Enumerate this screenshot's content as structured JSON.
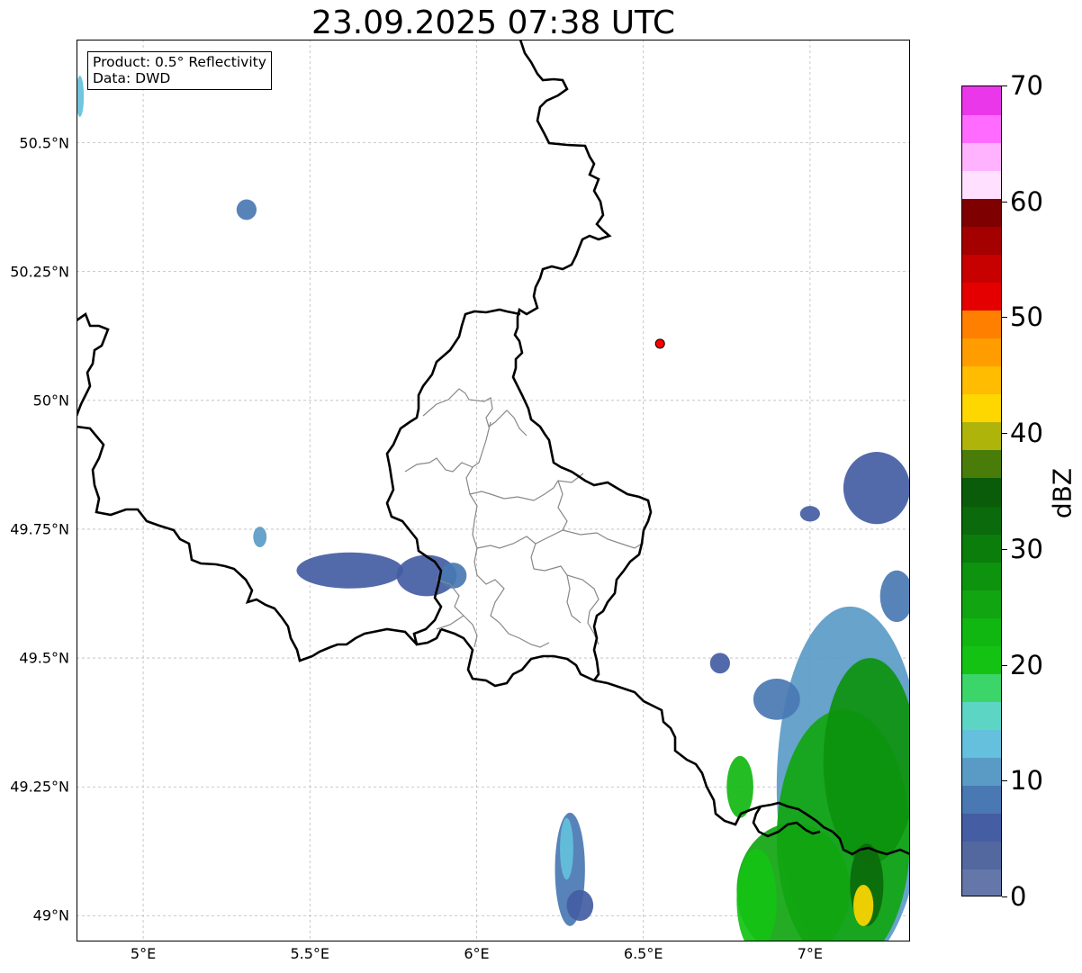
{
  "title": "23.09.2025 07:38 UTC",
  "info": {
    "product": "Product: 0.5° Reflectivity",
    "data": "Data: DWD"
  },
  "colorbar": {
    "label": "dBZ",
    "min": 0,
    "max": 70,
    "ticks": [
      "0",
      "10",
      "20",
      "30",
      "40",
      "50",
      "60",
      "70"
    ],
    "colors": [
      "#6577a9",
      "#52689f",
      "#445da3",
      "#4978b3",
      "#5a9bc6",
      "#64c0dc",
      "#5dd5c4",
      "#3cd569",
      "#14c214",
      "#11b711",
      "#11a511",
      "#0d930d",
      "#0b7d0b",
      "#0b6a0b",
      "#0a5c0a",
      "#4a7c0a",
      "#afb40a",
      "#ffd700",
      "#ffbc00",
      "#ff9d00",
      "#ff7f00",
      "#e40000",
      "#c70000",
      "#a50000",
      "#7f0000",
      "#ffe1ff",
      "#ffb3ff",
      "#ff6bff",
      "#ea37ea"
    ]
  },
  "map": {
    "lon_range": [
      4.8,
      7.3
    ],
    "lat_range": [
      48.95,
      50.7
    ],
    "lat_ticks": [
      {
        "value": 49.0,
        "label": "49°N"
      },
      {
        "value": 49.25,
        "label": "49.25°N"
      },
      {
        "value": 49.5,
        "label": "49.5°N"
      },
      {
        "value": 49.75,
        "label": "49.75°N"
      },
      {
        "value": 50.0,
        "label": "50°N"
      },
      {
        "value": 50.25,
        "label": "50.25°N"
      },
      {
        "value": 50.5,
        "label": "50.5°N"
      }
    ],
    "lon_ticks": [
      {
        "value": 5.0,
        "label": "5°E"
      },
      {
        "value": 5.5,
        "label": "5.5°E"
      },
      {
        "value": 6.0,
        "label": "6°E"
      },
      {
        "value": 6.5,
        "label": "6.5°E"
      },
      {
        "value": 7.0,
        "label": "7°E"
      }
    ],
    "radar_site": {
      "lon": 6.55,
      "lat": 50.11,
      "color": "#ff0000"
    },
    "gridline_color": "#bbbbbb",
    "border_color": "#000000",
    "district_color": "#888888"
  },
  "echoes": [
    {
      "lon": 6.28,
      "lat": 49.09,
      "rlon": 0.045,
      "rlat": 0.11,
      "dbz": 8
    },
    {
      "lon": 6.27,
      "lat": 49.13,
      "rlon": 0.02,
      "rlat": 0.06,
      "dbz": 13
    },
    {
      "lon": 6.31,
      "lat": 49.02,
      "rlon": 0.04,
      "rlat": 0.03,
      "dbz": 5
    },
    {
      "lon": 5.62,
      "lat": 49.67,
      "rlon": 0.16,
      "rlat": 0.035,
      "dbz": 5
    },
    {
      "lon": 5.85,
      "lat": 49.66,
      "rlon": 0.09,
      "rlat": 0.04,
      "dbz": 6
    },
    {
      "lon": 5.93,
      "lat": 49.66,
      "rlon": 0.04,
      "rlat": 0.025,
      "dbz": 8
    },
    {
      "lon": 5.31,
      "lat": 50.37,
      "rlon": 0.03,
      "rlat": 0.02,
      "dbz": 8
    },
    {
      "lon": 5.35,
      "lat": 49.735,
      "rlon": 0.02,
      "rlat": 0.02,
      "dbz": 12
    },
    {
      "lon": 4.81,
      "lat": 50.59,
      "rlon": 0.012,
      "rlat": 0.04,
      "dbz": 14
    },
    {
      "lon": 7.2,
      "lat": 49.83,
      "rlon": 0.1,
      "rlat": 0.07,
      "dbz": 6
    },
    {
      "lon": 7.12,
      "lat": 49.25,
      "rlon": 0.22,
      "rlat": 0.35,
      "dbz": 12
    },
    {
      "lon": 7.1,
      "lat": 49.15,
      "rlon": 0.2,
      "rlat": 0.25,
      "dbz": 25
    },
    {
      "lon": 7.18,
      "lat": 49.3,
      "rlon": 0.14,
      "rlat": 0.2,
      "dbz": 27
    },
    {
      "lon": 6.95,
      "lat": 49.05,
      "rlon": 0.17,
      "rlat": 0.13,
      "dbz": 26
    },
    {
      "lon": 6.84,
      "lat": 49.03,
      "rlon": 0.06,
      "rlat": 0.1,
      "dbz": 20
    },
    {
      "lon": 6.79,
      "lat": 49.25,
      "rlon": 0.04,
      "rlat": 0.06,
      "dbz": 22
    },
    {
      "lon": 6.9,
      "lat": 49.42,
      "rlon": 0.07,
      "rlat": 0.04,
      "dbz": 8
    },
    {
      "lon": 7.17,
      "lat": 49.06,
      "rlon": 0.05,
      "rlat": 0.08,
      "dbz": 33
    },
    {
      "lon": 7.16,
      "lat": 49.02,
      "rlon": 0.03,
      "rlat": 0.04,
      "dbz": 42
    },
    {
      "lon": 6.73,
      "lat": 49.49,
      "rlon": 0.03,
      "rlat": 0.02,
      "dbz": 6
    },
    {
      "lon": 7.26,
      "lat": 49.62,
      "rlon": 0.05,
      "rlat": 0.05,
      "dbz": 9
    },
    {
      "lon": 7.0,
      "lat": 49.78,
      "rlon": 0.03,
      "rlat": 0.015,
      "dbz": 6
    }
  ]
}
